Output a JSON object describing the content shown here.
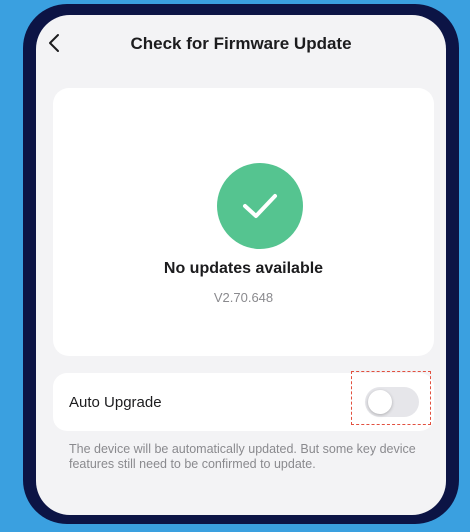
{
  "header": {
    "title": "Check for Firmware Update"
  },
  "status": {
    "title": "No updates available",
    "version": "V2.70.648"
  },
  "auto_upgrade": {
    "label": "Auto Upgrade",
    "enabled": false,
    "description": "The device will be automatically updated. But some key device features still need to be confirmed to update."
  },
  "icons": {
    "back": "chevron-left-icon",
    "status": "checkmark-icon"
  },
  "colors": {
    "background": "#3aa0e0",
    "frame": "#0c1445",
    "success": "#55c490",
    "highlight": "#e2503f"
  }
}
